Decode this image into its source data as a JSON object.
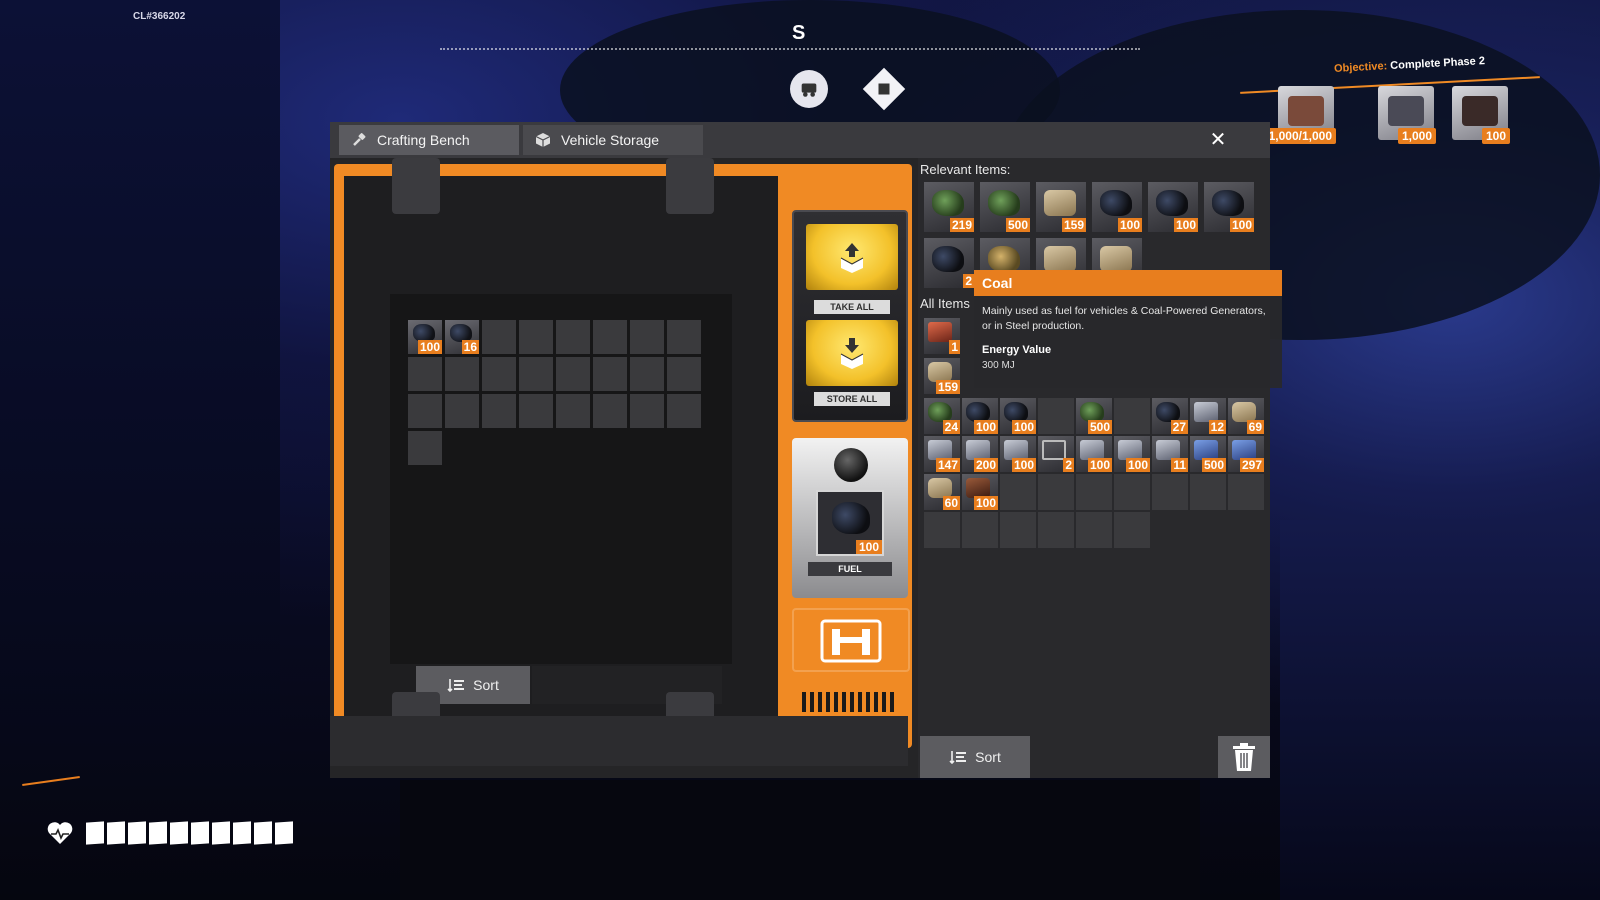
{
  "hud": {
    "build_id": "CL#366202",
    "compass_letter": "S",
    "objective_label": "Objective:",
    "objective_text": "Complete Phase 2",
    "objective_items": [
      {
        "count": "1,000/1,000"
      },
      {
        "count": "1,000"
      },
      {
        "count": "100"
      }
    ],
    "health_segments": 10
  },
  "window": {
    "tabs": [
      {
        "label": "Crafting Bench",
        "icon": "hammer-icon"
      },
      {
        "label": "Vehicle Storage",
        "icon": "box-icon"
      }
    ],
    "close_label": "✕"
  },
  "storage": {
    "slots": [
      {
        "qty": "100",
        "type": "coal"
      },
      {
        "qty": "16",
        "type": "coal"
      }
    ],
    "total_slots": 25,
    "sort_label": "Sort"
  },
  "controls": {
    "take_all_label": "TAKE ALL",
    "store_all_label": "STORE ALL",
    "fuel_label": "FUEL",
    "fuel_qty": "100"
  },
  "inventory": {
    "relevant_title": "Relevant Items:",
    "all_title": "All Items",
    "relevant_items": [
      {
        "qty": "219",
        "art": "plant"
      },
      {
        "qty": "500",
        "art": "plant"
      },
      {
        "qty": "159",
        "art": "log"
      },
      {
        "qty": "100",
        "art": "coal"
      },
      {
        "qty": "100",
        "art": "coal"
      },
      {
        "qty": "100",
        "art": "coal"
      },
      {
        "qty": "2",
        "art": "coal"
      },
      {
        "qty": "",
        "art": "ore"
      },
      {
        "qty": "",
        "art": "log"
      },
      {
        "qty": "",
        "art": "log"
      }
    ],
    "all_rows": [
      [
        {
          "qty": "1",
          "art": "red"
        }
      ],
      [
        {
          "qty": "159",
          "art": "log"
        }
      ],
      [
        {
          "qty": "24",
          "art": "plant"
        },
        {
          "qty": "100",
          "art": "coal"
        },
        {
          "qty": "100",
          "art": "coal"
        },
        {
          "qty": "",
          "art": ""
        },
        {
          "qty": "500",
          "art": "plant"
        },
        {
          "qty": "",
          "art": ""
        },
        {
          "qty": "27",
          "art": "coal"
        },
        {
          "qty": "12",
          "art": "metal"
        },
        {
          "qty": "69",
          "art": "log"
        }
      ],
      [
        {
          "qty": "147",
          "art": "metal"
        },
        {
          "qty": "200",
          "art": "metal"
        },
        {
          "qty": "100",
          "art": "metal"
        },
        {
          "qty": "2",
          "art": "cube"
        },
        {
          "qty": "100",
          "art": "metal"
        },
        {
          "qty": "100",
          "art": "metal"
        },
        {
          "qty": "11",
          "art": "metal"
        },
        {
          "qty": "500",
          "art": "blue"
        },
        {
          "qty": "297",
          "art": "blue"
        }
      ],
      [
        {
          "qty": "60",
          "art": "log"
        },
        {
          "qty": "100",
          "art": "barrel"
        },
        {
          "qty": "",
          "art": ""
        },
        {
          "qty": "",
          "art": ""
        },
        {
          "qty": "",
          "art": ""
        },
        {
          "qty": "",
          "art": ""
        },
        {
          "qty": "",
          "art": ""
        },
        {
          "qty": "",
          "art": ""
        },
        {
          "qty": "",
          "art": ""
        }
      ],
      [
        {
          "qty": "",
          "art": ""
        },
        {
          "qty": "",
          "art": ""
        },
        {
          "qty": "",
          "art": ""
        },
        {
          "qty": "",
          "art": ""
        },
        {
          "qty": "",
          "art": ""
        },
        {
          "qty": "",
          "art": ""
        }
      ]
    ],
    "sort_label": "Sort"
  },
  "tooltip": {
    "title": "Coal",
    "description": "Mainly used as fuel for vehicles & Coal-Powered Generators, or in Steel production.",
    "stat_label": "Energy Value",
    "stat_value": "300 MJ"
  },
  "colors": {
    "accent": "#f08a24",
    "badge": "#e87e1e",
    "panel": "#252527"
  }
}
